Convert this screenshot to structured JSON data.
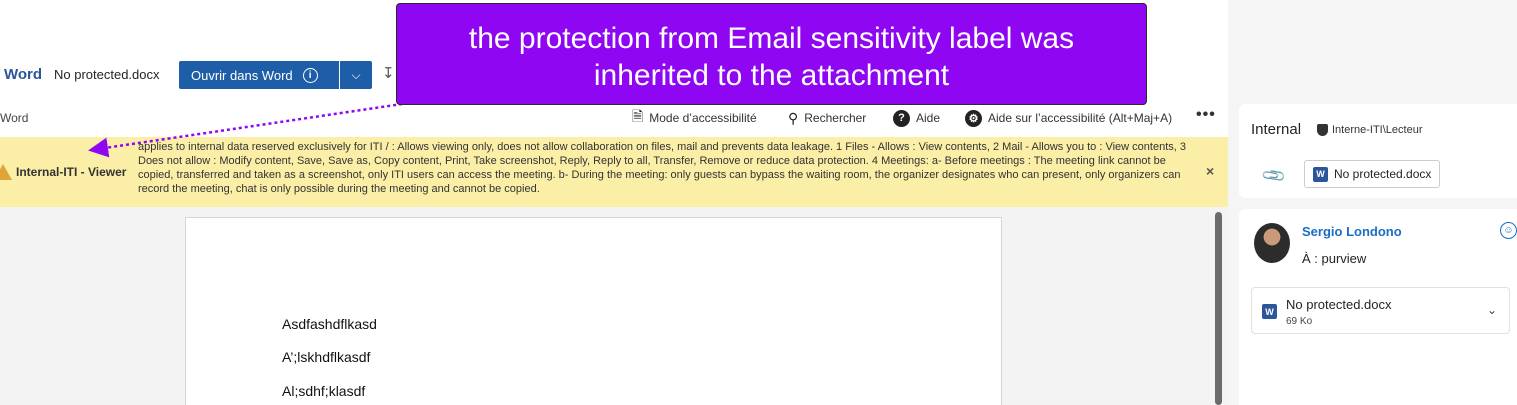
{
  "header": {
    "app_name": "Word",
    "file_name": "No protected.docx",
    "open_button_label": "Ouvrir dans Word",
    "open_button_info_icon": "info-icon",
    "dropdown_icon": "chevron-down-icon",
    "download_icon": "download-icon"
  },
  "toolbar": {
    "word_label": "Word",
    "accessibility_mode_label": "Mode d’accessibilité",
    "search_label": "Rechercher",
    "help_label": "Aide",
    "accessibility_help_label": "Aide sur l’accessibilité (Alt+Maj+A)",
    "more_label": "•••"
  },
  "banner": {
    "label": "Internal-ITI - Viewer",
    "text": "applies to internal data reserved exclusively for ITI / : Allows viewing only, does not allow collaboration on files, mail and prevents data leakage. 1 Files - Allows : View contents, 2 Mail - Allows you to : View contents, 3 Does not allow : Modify content, Save, Save as, Copy content, Print, Take screenshot, Reply, Reply to all, Transfer, Remove or reduce data protection. 4 Meetings: a- Before meetings : The meeting link cannot be copied, transferred and taken as a screenshot, only ITI users can access the meeting. b- During the meeting: only guests can bypass the waiting room, the organizer designates who can present, only organizers can record the meeting, chat is only possible during the meeting and cannot be copied.",
    "close_label": "×"
  },
  "document": {
    "lines": [
      "Asdfashdflkasd",
      "A’;lskhdflkasdf",
      "Al;sdhf;klasdf"
    ]
  },
  "mail": {
    "sensitivity_label": "Internal",
    "sensitivity_sublabel": "Interne-ITI\\Lecteur",
    "attachment_chip": "No protected.docx",
    "sender_name": "Sergio Londono",
    "to_line": "À :  purview",
    "attachment_name": "No protected.docx",
    "attachment_size": "69 Ko"
  },
  "callout": {
    "text_line1": "the protection from Email sensitivity label was",
    "text_line2": "inherited to the attachment",
    "color": "#8f07f2"
  },
  "colors": {
    "word_blue": "#2b579a",
    "button_blue": "#1e5ea8",
    "banner_yellow": "#fbeea6",
    "link_blue": "#1b6ec2",
    "arrow_purple": "#8f07f2"
  }
}
